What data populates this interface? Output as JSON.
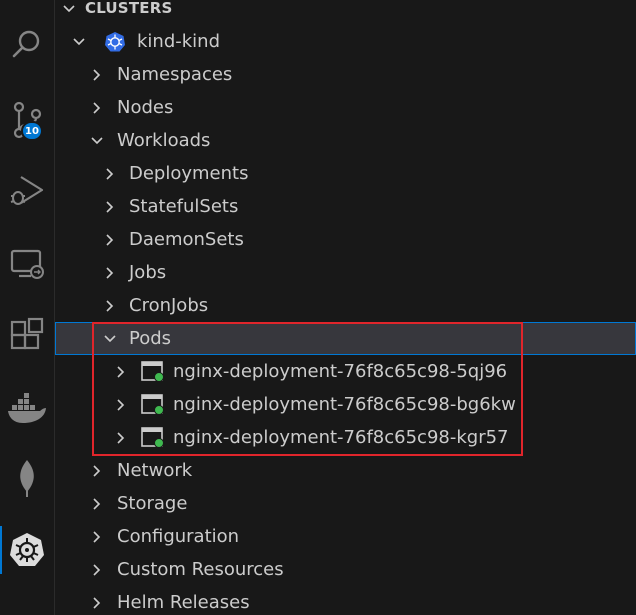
{
  "activity_bar": {
    "items": [
      {
        "name": "search-icon"
      },
      {
        "name": "source-control-icon",
        "badge": "10"
      },
      {
        "name": "run-debug-icon"
      },
      {
        "name": "remote-explorer-icon"
      },
      {
        "name": "extensions-icon"
      },
      {
        "name": "docker-icon"
      },
      {
        "name": "mongodb-leaf-icon"
      },
      {
        "name": "kubernetes-icon"
      }
    ]
  },
  "tree": {
    "section_title": "CLUSTERS",
    "cluster": "kind-kind",
    "top_items": [
      "Namespaces",
      "Nodes",
      "Workloads"
    ],
    "workload_items": [
      "Deployments",
      "StatefulSets",
      "DaemonSets",
      "Jobs",
      "CronJobs"
    ],
    "pods_label": "Pods",
    "pods": [
      "nginx-deployment-76f8c65c98-5qj96",
      "nginx-deployment-76f8c65c98-bg6kw",
      "nginx-deployment-76f8c65c98-kgr57"
    ],
    "bottom_items": [
      "Network",
      "Storage",
      "Configuration",
      "Custom Resources",
      "Helm Releases"
    ]
  },
  "colors": {
    "accent": "#0078d4",
    "highlight_border": "#e0252b",
    "pod_status_green": "#3fb950"
  }
}
